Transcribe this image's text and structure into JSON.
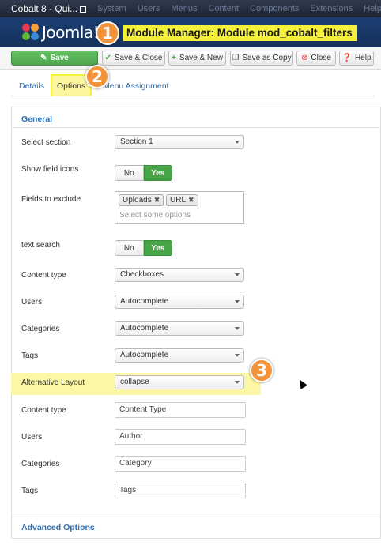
{
  "topnav": {
    "site_name": "Cobalt 8 - Qui...",
    "menu": [
      "System",
      "Users",
      "Menus",
      "Content",
      "Components",
      "Extensions",
      "Help"
    ]
  },
  "header": {
    "logo_text": "Joomla!",
    "title": "Module Manager: Module mod_cobalt_filters"
  },
  "badges": [
    "1",
    "2",
    "3"
  ],
  "toolbar": {
    "save": "Save",
    "save_close": "Save & Close",
    "save_new": "Save & New",
    "save_copy": "Save as Copy",
    "close": "Close",
    "help": "Help"
  },
  "tabs": [
    "Details",
    "Options",
    "Menu Assignment"
  ],
  "panel": {
    "title": "General",
    "fields": {
      "select_section": {
        "label": "Select section",
        "value": "Section 1"
      },
      "show_field_icons": {
        "label": "Show field icons",
        "no": "No",
        "yes": "Yes",
        "selected": "Yes"
      },
      "fields_to_exclude": {
        "label": "Fields to exclude",
        "chips": [
          "Uploads",
          "URL"
        ],
        "placeholder": "Select some options"
      },
      "text_search": {
        "label": "text search",
        "no": "No",
        "yes": "Yes",
        "selected": "Yes"
      },
      "content_type": {
        "label": "Content type",
        "value": "Checkboxes"
      },
      "users": {
        "label": "Users",
        "value": "Autocomplete"
      },
      "categories": {
        "label": "Categories",
        "value": "Autocomplete"
      },
      "tags": {
        "label": "Tags",
        "value": "Autocomplete"
      },
      "alternative_layout": {
        "label": "Alternative Layout",
        "value": "collapse"
      },
      "content_type_label": {
        "label": "Content type",
        "value": "Content Type"
      },
      "users_label": {
        "label": "Users",
        "value": "Author"
      },
      "categories_label": {
        "label": "Categories",
        "value": "Category"
      },
      "tags_label": {
        "label": "Tags",
        "value": "Tags"
      }
    }
  },
  "panel2": {
    "title": "Advanced Options"
  },
  "colors": {
    "nav_bg": "#1d2533",
    "header_bg": "#16315b",
    "accent": "#2a6fb5",
    "highlight": "#f5f03a",
    "badge": "#f3933a",
    "success": "#46a546"
  }
}
